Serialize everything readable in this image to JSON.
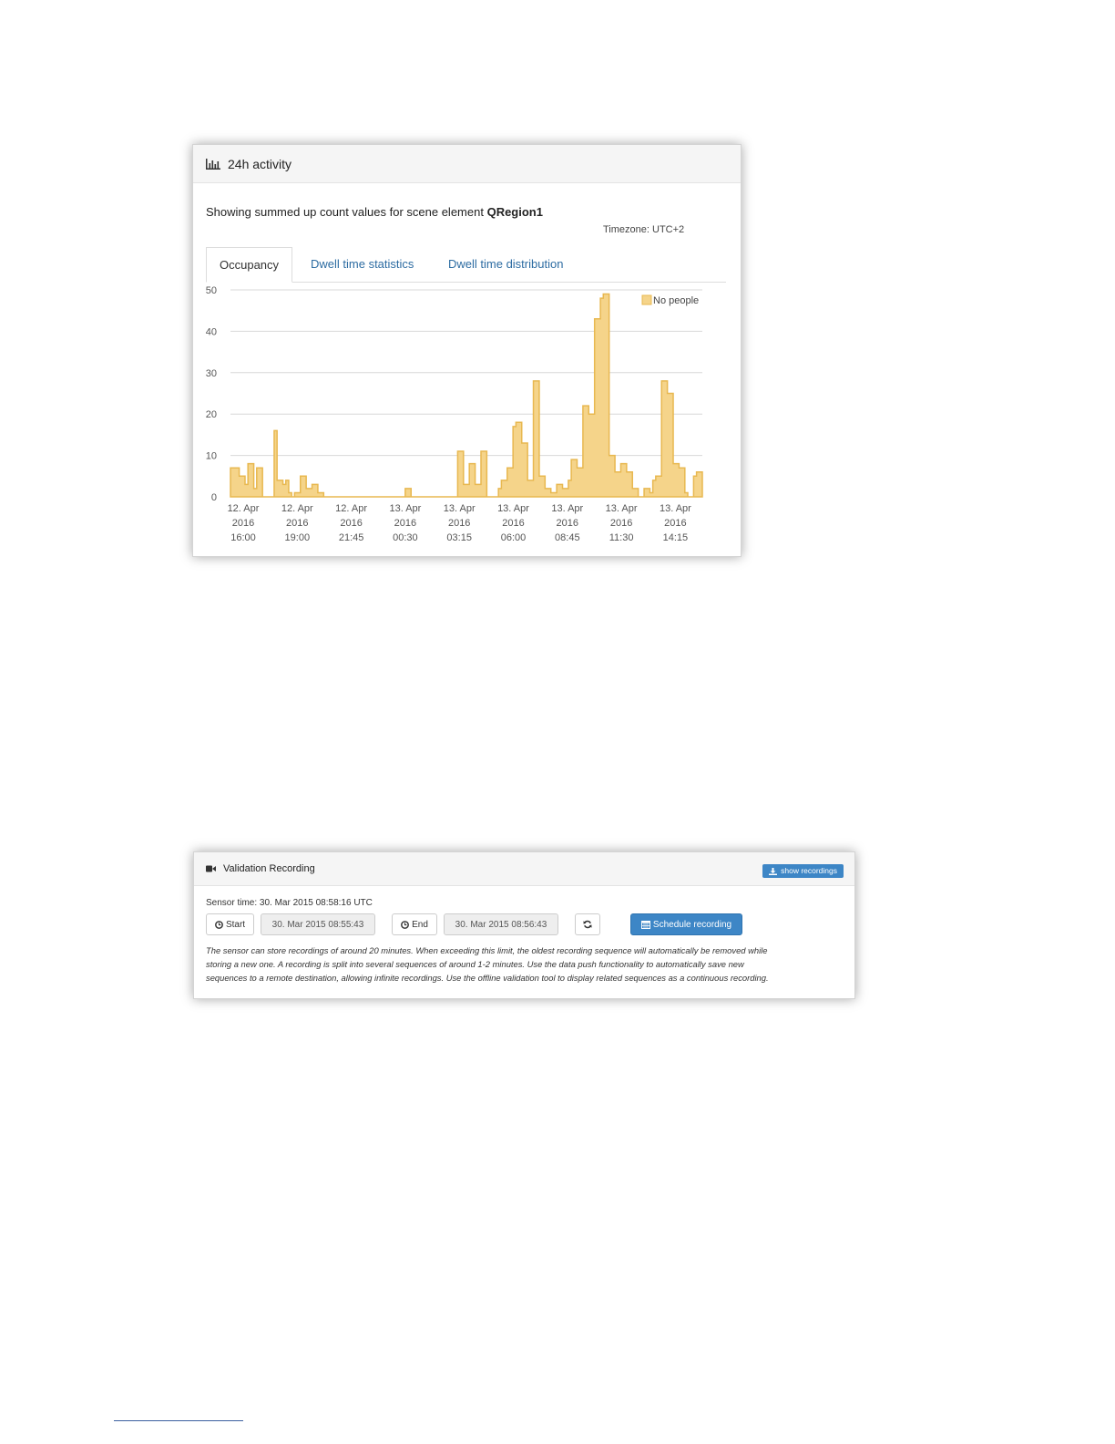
{
  "activity_panel": {
    "title": "24h activity",
    "subtitle_prefix": "Showing summed up count values for scene element",
    "scene_element": "QRegion1",
    "timezone": "Timezone: UTC+2",
    "tabs": [
      {
        "label": "Occupancy",
        "active": true
      },
      {
        "label": "Dwell time statistics",
        "active": false
      },
      {
        "label": "Dwell time distribution",
        "active": false
      }
    ]
  },
  "chart_data": {
    "type": "area",
    "step": true,
    "ylim": [
      0,
      50
    ],
    "yticks": [
      0,
      10,
      20,
      30,
      40,
      50
    ],
    "grid": true,
    "legend_position": "top-right",
    "series": [
      {
        "name": "No people",
        "color": "#f5d48a",
        "stroke": "#e8b850",
        "values": [
          7,
          7,
          7,
          5,
          5,
          3,
          8,
          8,
          2,
          7,
          7,
          0,
          0,
          0,
          0,
          16,
          4,
          4,
          3,
          4,
          1,
          0,
          1,
          1,
          5,
          5,
          2,
          2,
          3,
          3,
          1,
          1,
          0,
          0,
          0,
          0,
          0,
          0,
          0,
          0,
          0,
          0,
          0,
          0,
          0,
          0,
          0,
          0,
          0,
          0,
          0,
          0,
          0,
          0,
          0,
          0,
          0,
          0,
          0,
          0,
          2,
          2,
          0,
          0,
          0,
          0,
          0,
          0,
          0,
          0,
          0,
          0,
          0,
          0,
          0,
          0,
          0,
          0,
          11,
          11,
          3,
          3,
          8,
          8,
          3,
          3,
          11,
          11,
          0,
          0,
          0,
          0,
          2,
          4,
          4,
          7,
          7,
          17,
          18,
          18,
          13,
          13,
          4,
          4,
          28,
          28,
          5,
          5,
          2,
          2,
          1,
          1,
          3,
          3,
          2,
          2,
          4,
          9,
          9,
          7,
          7,
          22,
          22,
          20,
          20,
          43,
          43,
          48,
          49,
          49,
          10,
          10,
          6,
          6,
          8,
          8,
          6,
          6,
          2,
          2,
          0,
          0,
          2,
          2,
          1,
          4,
          5,
          5,
          28,
          28,
          25,
          25,
          8,
          8,
          7,
          7,
          1,
          0,
          0,
          5,
          6,
          6
        ]
      }
    ],
    "x_ticks": [
      {
        "line1": "12. Apr",
        "line2": "2016",
        "line3": "16:00"
      },
      {
        "line1": "12. Apr",
        "line2": "2016",
        "line3": "19:00"
      },
      {
        "line1": "12. Apr",
        "line2": "2016",
        "line3": "21:45"
      },
      {
        "line1": "13. Apr",
        "line2": "2016",
        "line3": "00:30"
      },
      {
        "line1": "13. Apr",
        "line2": "2016",
        "line3": "03:15"
      },
      {
        "line1": "13. Apr",
        "line2": "2016",
        "line3": "06:00"
      },
      {
        "line1": "13. Apr",
        "line2": "2016",
        "line3": "08:45"
      },
      {
        "line1": "13. Apr",
        "line2": "2016",
        "line3": "11:30"
      },
      {
        "line1": "13. Apr",
        "line2": "2016",
        "line3": "14:15"
      }
    ]
  },
  "recording_panel": {
    "title": "Validation Recording",
    "show_recordings_label": "show recordings",
    "sensor_time": "Sensor time: 30. Mar 2015 08:58:16 UTC",
    "start_label": "Start",
    "start_value": "30. Mar 2015 08:55:43",
    "end_label": "End",
    "end_value": "30. Mar 2015 08:56:43",
    "schedule_label": "Schedule recording",
    "note_lines": [
      "The sensor can store recordings of around 20 minutes. When exceeding this limit, the oldest recording sequence will automatically be removed while",
      "storing a new one. A recording is split into several sequences of around 1-2 minutes. Use the data push functionality to automatically save new",
      "sequences to a remote destination, allowing infinite recordings. Use the offline validation tool to display related sequences as a continuous recording."
    ]
  },
  "icons": {
    "chart": "bar-chart-icon",
    "camera": "video-camera-icon",
    "download": "download-icon",
    "clock": "clock-icon",
    "refresh": "refresh-icon",
    "calendar": "calendar-icon"
  }
}
